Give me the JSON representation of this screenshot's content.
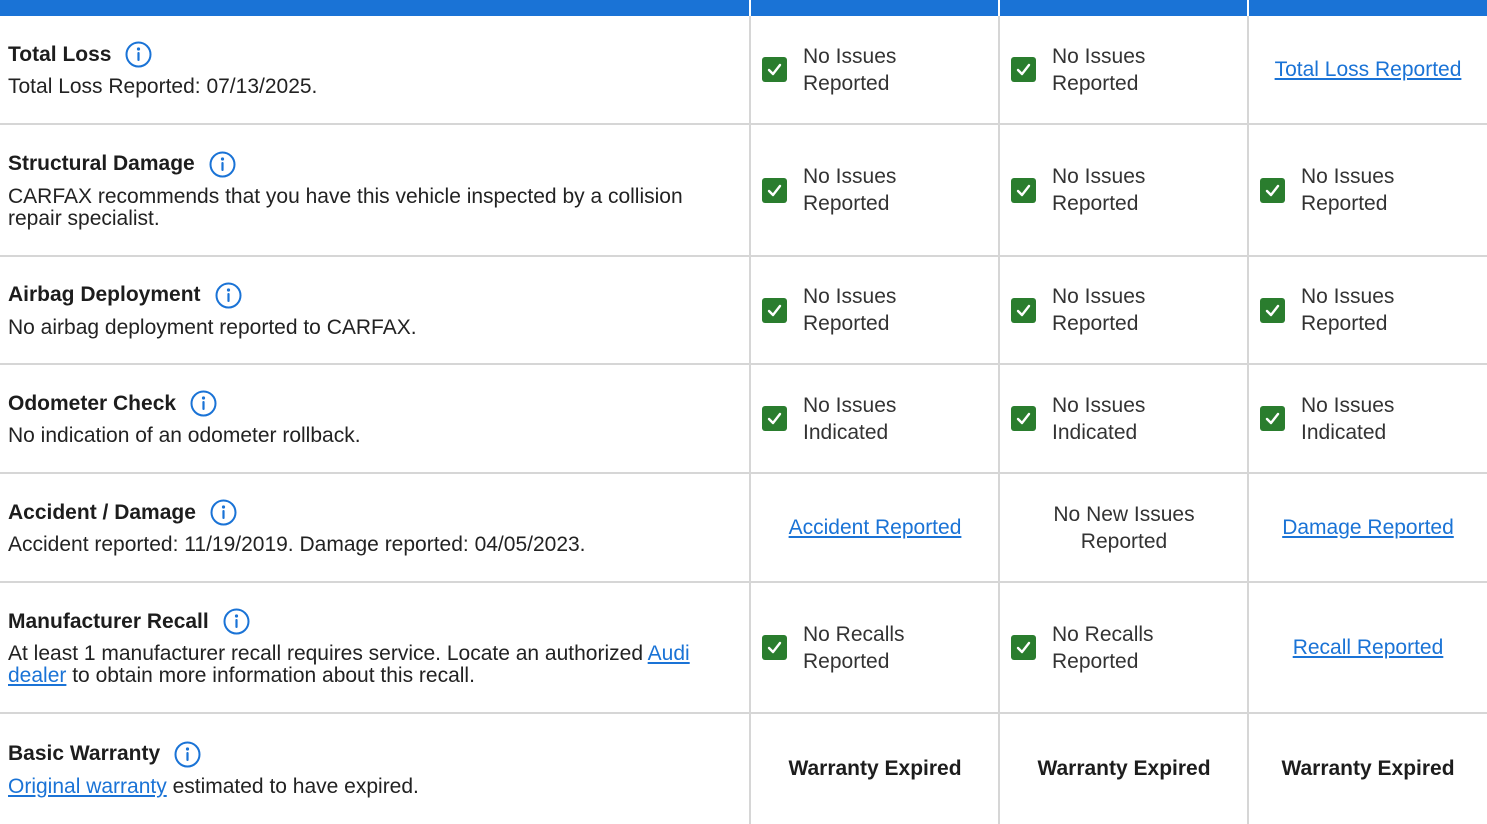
{
  "colors": {
    "header": "#1a73d6",
    "link": "#1a73d6",
    "check": "#2a7d2e",
    "divider": "#d6d6d6"
  },
  "rows": [
    {
      "title": "Total Loss",
      "body": "Total Loss Reported: 07/13/2025.",
      "cells": [
        {
          "kind": "check",
          "text": "No Issues Reported"
        },
        {
          "kind": "check",
          "text": "No Issues Reported"
        },
        {
          "kind": "link",
          "text": "Total Loss Reported"
        }
      ]
    },
    {
      "title": "Structural Damage",
      "body": "CARFAX recommends that you have this vehicle inspected by a collision repair specialist.",
      "cells": [
        {
          "kind": "check",
          "text": "No Issues Reported"
        },
        {
          "kind": "check",
          "text": "No Issues Reported"
        },
        {
          "kind": "check",
          "text": "No Issues Reported"
        }
      ]
    },
    {
      "title": "Airbag Deployment",
      "body": "No airbag deployment reported to CARFAX.",
      "cells": [
        {
          "kind": "check",
          "text": "No Issues Reported"
        },
        {
          "kind": "check",
          "text": "No Issues Reported"
        },
        {
          "kind": "check",
          "text": "No Issues Reported"
        }
      ]
    },
    {
      "title": "Odometer Check",
      "body": "No indication of an odometer rollback.",
      "cells": [
        {
          "kind": "check",
          "text": "No Issues Indicated"
        },
        {
          "kind": "check",
          "text": "No Issues Indicated"
        },
        {
          "kind": "check",
          "text": "No Issues Indicated"
        }
      ]
    },
    {
      "title": "Accident / Damage",
      "body": "Accident reported: 11/19/2019. Damage reported: 04/05/2023.",
      "cells": [
        {
          "kind": "link",
          "text": "Accident Reported"
        },
        {
          "kind": "text",
          "text": "No New Issues Reported"
        },
        {
          "kind": "link",
          "text": "Damage Reported"
        }
      ]
    },
    {
      "title": "Manufacturer Recall",
      "body_prefix": "At least 1 manufacturer recall requires service. Locate an authorized ",
      "body_link": "Audi dealer",
      "body_suffix": " to obtain more information about this recall.",
      "cells": [
        {
          "kind": "check",
          "text": "No Recalls Reported"
        },
        {
          "kind": "check",
          "text": "No Recalls Reported"
        },
        {
          "kind": "link",
          "text": "Recall Reported"
        }
      ]
    },
    {
      "title": "Basic Warranty",
      "body_link": "Original warranty",
      "body_suffix": " estimated to have expired.",
      "cells": [
        {
          "kind": "bold",
          "text": "Warranty Expired"
        },
        {
          "kind": "bold",
          "text": "Warranty Expired"
        },
        {
          "kind": "bold",
          "text": "Warranty Expired"
        }
      ]
    }
  ]
}
